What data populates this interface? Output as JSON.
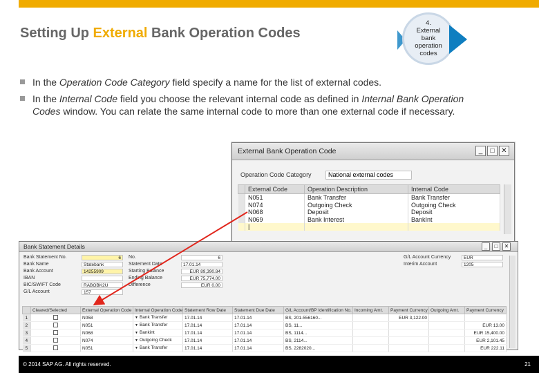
{
  "slide": {
    "title_pre": "Setting Up ",
    "title_hl": "External",
    "title_post": " Bank Operation Codes",
    "step_lines": [
      "4.",
      "External",
      "bank",
      "operation",
      "codes"
    ],
    "accent_color": "#f0ab00",
    "bullet1": {
      "a": "In the ",
      "b": "Operation Code Category",
      "c": " field specify a name for the list of external codes."
    },
    "bullet2": {
      "a": "In the ",
      "b": "Internal Code",
      "c": " field you choose the relevant internal code as defined in ",
      "d": "Internal Bank Operation Codes",
      "e": " window. You can relate the same internal code to more than one external code if necessary."
    },
    "footer_copy": "© 2014 SAP AG. All rights reserved.",
    "page_number": "21"
  },
  "window1": {
    "title": "External Bank Operation Code",
    "category_label": "Operation Code Category",
    "category_value": "National external codes",
    "columns": [
      "External Code",
      "Operation Description",
      "Internal Code"
    ],
    "rows": [
      [
        "N051",
        "Bank Transfer",
        "Bank Transfer"
      ],
      [
        "N074",
        "Outgoing Check",
        "Outgoing Check"
      ],
      [
        "N068",
        "Deposit",
        "Deposit"
      ],
      [
        "N069",
        "Bank Interest",
        "BankInt"
      ],
      [
        "",
        "",
        ""
      ]
    ]
  },
  "window2": {
    "title": "Bank Statement Details",
    "left_fields": [
      {
        "label": "Bank Statement No.",
        "value": "6"
      },
      {
        "label": "Bank Name",
        "value": "Statebank"
      },
      {
        "label": "Bank Account",
        "value": "14255909"
      },
      {
        "label": "IBAN",
        "value": ""
      },
      {
        "label": "BIC/SWIFT Code",
        "value": "RABOBK2U"
      },
      {
        "label": "G/L Account",
        "value": "157"
      }
    ],
    "mid_fields": [
      {
        "label": "No.",
        "value": "6"
      },
      {
        "label": "Statement Date",
        "value": "17.01.14"
      },
      {
        "label": "Starting Balance",
        "value": "EUR 89,390.84"
      },
      {
        "label": "Ending Balance",
        "value": "EUR 75,774.00"
      },
      {
        "label": "Difference",
        "value": "EUR 0.00"
      }
    ],
    "right_fields": [
      {
        "label": "G/L Account Currency",
        "value": "EUR"
      },
      {
        "label": "Interim Account",
        "value": "1205"
      }
    ],
    "columns": [
      "Cleared/Selected",
      "External Operation Code",
      "Internal Operation Code",
      "Statement Row Date",
      "Statement Due Date",
      "G/L Account/BP Identification No.",
      "Incoming Amt.",
      "Payment Currency",
      "Outgoing Amt.",
      "Payment Currency"
    ],
    "rows": [
      [
        "1",
        "N058",
        "Bank Transfer",
        "17.01.14",
        "17.01.14",
        "BS, 201-556160...",
        "",
        "EUR 3,122.00",
        "",
        ""
      ],
      [
        "2",
        "N051",
        "Bank Transfer",
        "17.01.14",
        "17.01.14",
        "BS, 11...",
        "",
        "",
        "",
        "EUR 13.00"
      ],
      [
        "3",
        "N068",
        "Bankint",
        "17.01.14",
        "17.01.14",
        "BS, 1114...",
        "",
        "",
        "",
        "EUR 15,400.00"
      ],
      [
        "4",
        "N074",
        "Outgoing Check",
        "17.01.14",
        "17.01.14",
        "BS, 2114...",
        "",
        "",
        "",
        "EUR 2,101.45"
      ],
      [
        "5",
        "N051",
        "Bank Transfer",
        "17.01.14",
        "17.01.14",
        "BS, 2282020...",
        "",
        "",
        "",
        "EUR 222.11"
      ]
    ]
  }
}
